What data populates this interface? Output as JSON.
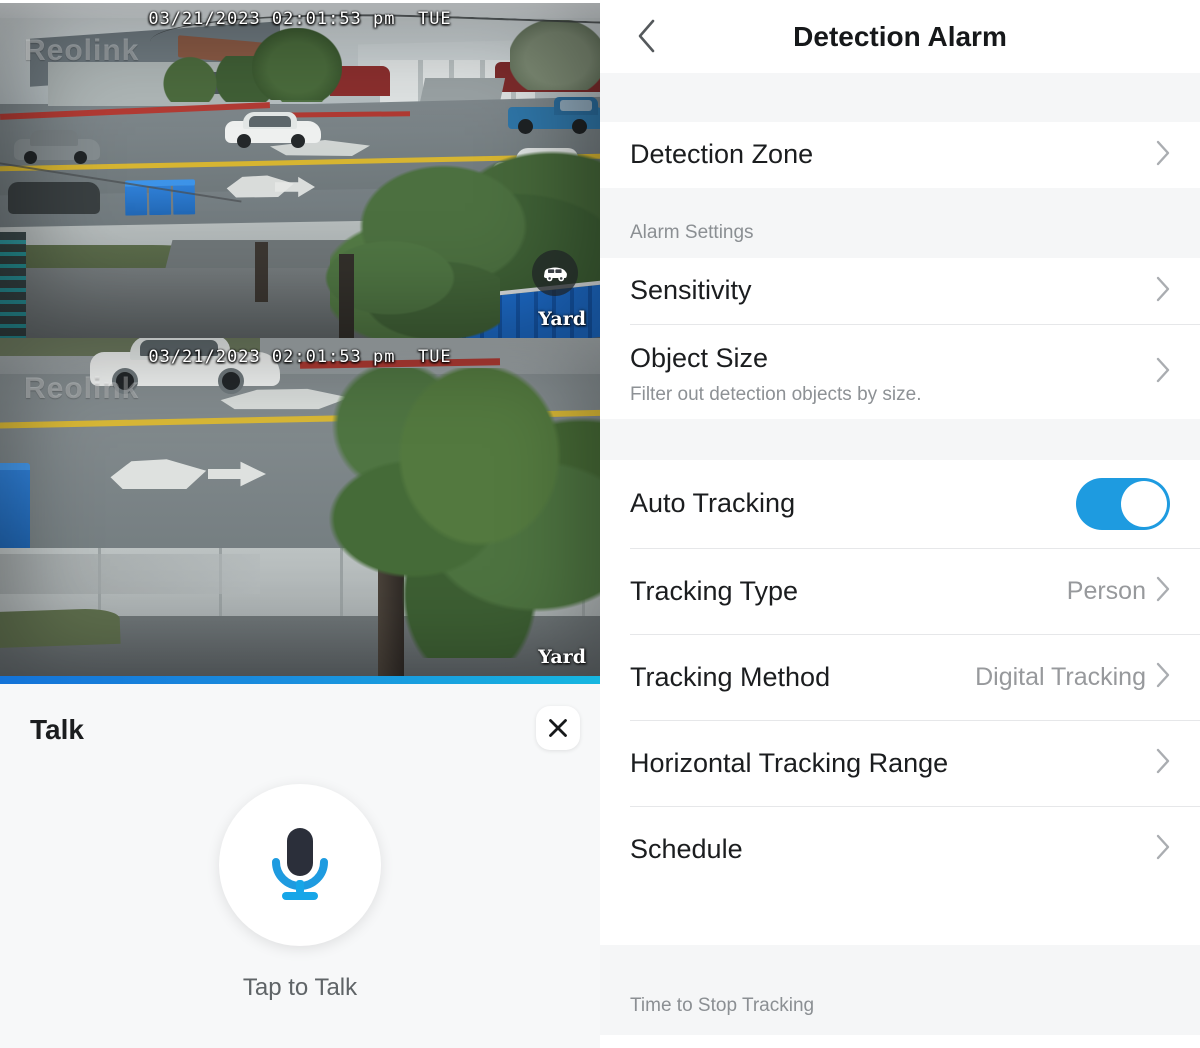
{
  "left": {
    "videos": [
      {
        "timestamp": "03/21/2023 02:01:53 pm  TUE",
        "watermark": "Reolink",
        "camera_label": "Yard",
        "badge_icon": "car-icon"
      },
      {
        "timestamp": "03/21/2023 02:01:53 pm  TUE",
        "watermark": "Reolink",
        "camera_label": "Yard"
      }
    ],
    "talk": {
      "title": "Talk",
      "close_icon": "close-icon",
      "mic_icon": "microphone-icon",
      "hint": "Tap to Talk"
    }
  },
  "right": {
    "nav": {
      "back_icon": "chevron-left-icon",
      "title": "Detection Alarm"
    },
    "detection_zone": {
      "label": "Detection Zone",
      "chevron": "chevron-right-icon"
    },
    "alarm_settings": {
      "header": "Alarm Settings",
      "rows": [
        {
          "label": "Sensitivity",
          "sub": "",
          "value": "",
          "chevron": "chevron-right-icon"
        },
        {
          "label": "Object Size",
          "sub": "Filter out detection objects by size.",
          "value": "",
          "chevron": "chevron-right-icon"
        }
      ]
    },
    "tracking": {
      "auto_tracking": {
        "label": "Auto Tracking",
        "toggle_state": "on"
      },
      "rows": [
        {
          "label": "Tracking Type",
          "value": "Person",
          "chevron": "chevron-right-icon"
        },
        {
          "label": "Tracking Method",
          "value": "Digital Tracking",
          "chevron": "chevron-right-icon"
        },
        {
          "label": "Horizontal Tracking Range",
          "value": "",
          "chevron": "chevron-right-icon"
        },
        {
          "label": "Schedule",
          "value": "",
          "chevron": "chevron-right-icon"
        }
      ]
    },
    "footer_header": "Time to Stop Tracking"
  },
  "colors": {
    "accent_blue": "#1e9be0",
    "divider_gradient_start": "#1473d8",
    "divider_gradient_end": "#16b6e0",
    "mic_head": "#2b2f3a",
    "mic_stand": "#16a6e8",
    "section_gray": "#f5f6f7"
  }
}
